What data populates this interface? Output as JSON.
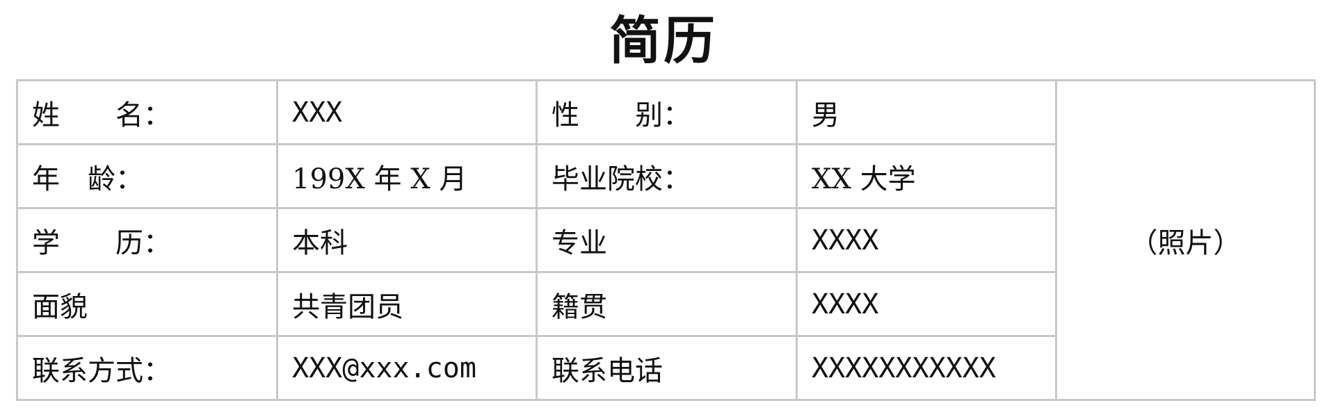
{
  "title": "简历",
  "rows": [
    {
      "label1": "姓　　名：",
      "value1": "XXX",
      "label2": "性　　别：",
      "value2": "男"
    },
    {
      "label1": "年　龄：",
      "value1": "199X 年 X 月",
      "label2": "毕业院校：",
      "value2": "XX 大学"
    },
    {
      "label1": "学　　历：",
      "value1": "本科",
      "label2": "专业",
      "value2": "XXXX"
    },
    {
      "label1": "面貌",
      "value1": "共青团员",
      "label2": "籍贯",
      "value2": "XXXX"
    },
    {
      "label1": "联系方式：",
      "value1": "XXX@xxx.com",
      "label2": "联系电话",
      "value2": "XXXXXXXXXXX"
    }
  ],
  "photo_label": "（照片）"
}
